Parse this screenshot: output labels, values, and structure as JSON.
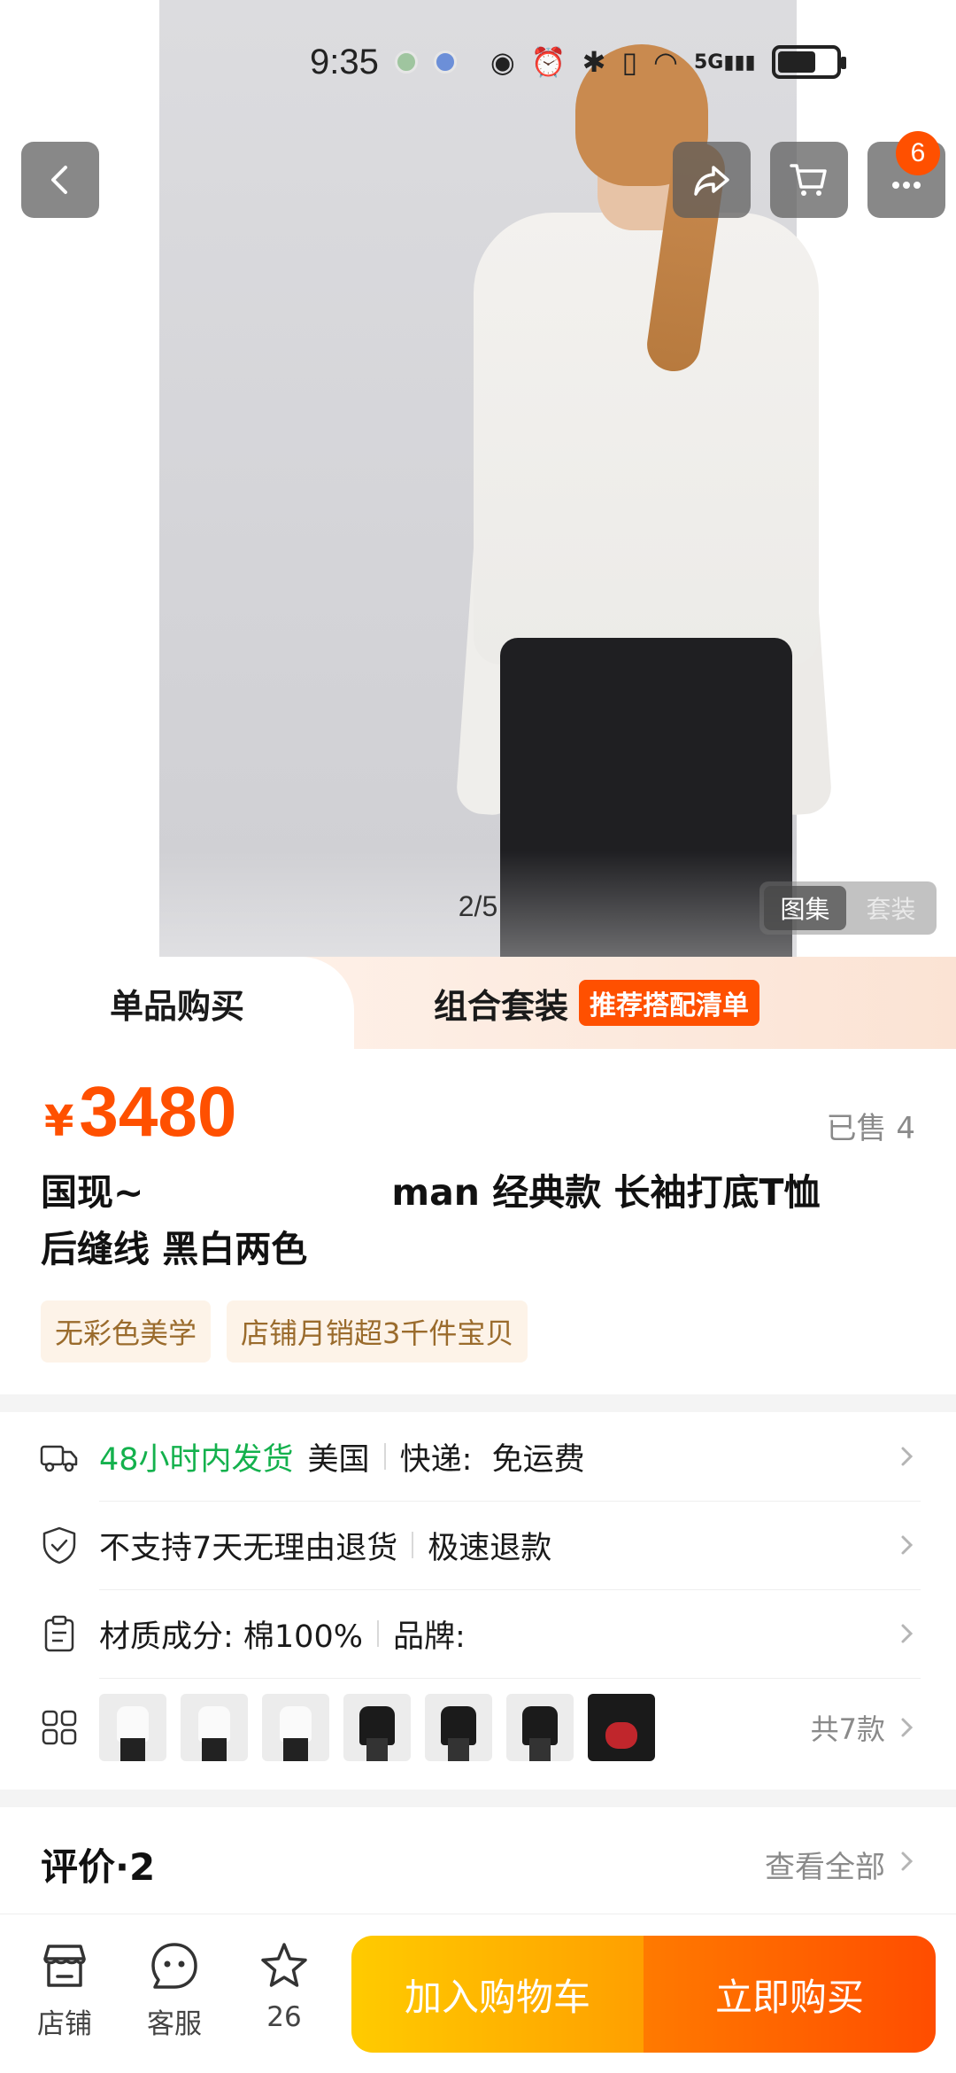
{
  "status_bar": {
    "time": "9:35",
    "network": "5G"
  },
  "header": {
    "cart_badge": "6"
  },
  "gallery": {
    "page_indicator": "2/5",
    "tab_album": "图集",
    "tab_set": "套装"
  },
  "buy_tabs": {
    "single": "单品购买",
    "combo": "组合套装",
    "combo_tag": "推荐搭配清单"
  },
  "product": {
    "currency": "¥",
    "price": "3480",
    "sold": "已售 4",
    "title_prefix": "国现~",
    "title_middle": "man 经典款 长袖打底T恤",
    "title_line2": "后缝线 黑白两色",
    "tags": [
      "无彩色美学",
      "店铺月销超3千件宝贝"
    ]
  },
  "services": {
    "shipping": {
      "highlight": "48小时内发货",
      "origin": "美国",
      "express": "快递:  免运费"
    },
    "returns": {
      "policy": "不支持7天无理由退货",
      "refund": "极速退款"
    },
    "material": {
      "composition": "材质成分: 棉100%",
      "brand": "品牌:"
    },
    "variants": {
      "count_label": "共7款"
    }
  },
  "reviews": {
    "title": "评价·2",
    "view_all": "查看全部"
  },
  "bottom_bar": {
    "shop": "店铺",
    "service": "客服",
    "fav_count": "26",
    "add_to_cart": "加入购物车",
    "buy_now": "立即购买"
  },
  "colors": {
    "accent": "#ff5000",
    "green": "#14b14d",
    "cart_yellow": "#ffb800"
  }
}
